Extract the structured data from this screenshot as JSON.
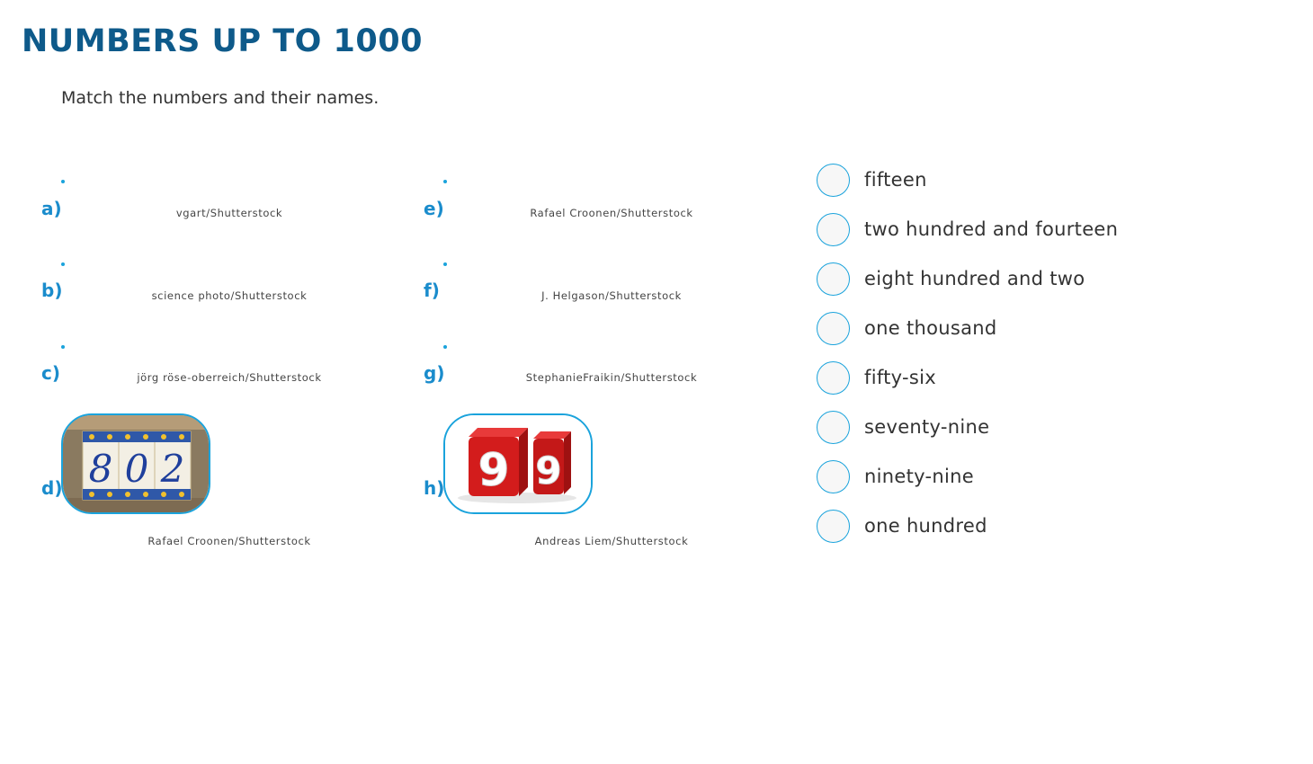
{
  "header": {
    "title": "NUMBERS UP TO 1000",
    "instruction": "Match the numbers and their names."
  },
  "items": [
    {
      "letter": "a)",
      "credit": "vgart/Shutterstock"
    },
    {
      "letter": "b)",
      "credit": "science photo/Shutterstock"
    },
    {
      "letter": "c)",
      "credit": "jörg röse-oberreich/Shutterstock"
    },
    {
      "letter": "d)",
      "credit": "Rafael Croonen/Shutterstock",
      "number_shown": "802"
    },
    {
      "letter": "e)",
      "credit": "Rafael Croonen/Shutterstock"
    },
    {
      "letter": "f)",
      "credit": "J. Helgason/Shutterstock"
    },
    {
      "letter": "g)",
      "credit": "StephanieFraikin/Shutterstock"
    },
    {
      "letter": "h)",
      "credit": "Andreas Liem/Shutterstock",
      "number_shown": "99"
    }
  ],
  "choices": [
    "fifteen",
    "two hundred and fourteen",
    "eight hundred and two",
    "one thousand",
    "fifty-six",
    "seventy-nine",
    "ninety-nine",
    "one hundred"
  ],
  "colors": {
    "title": "#0e5a8a",
    "accent": "#1aa3dc",
    "letter": "#1a8ccc"
  }
}
